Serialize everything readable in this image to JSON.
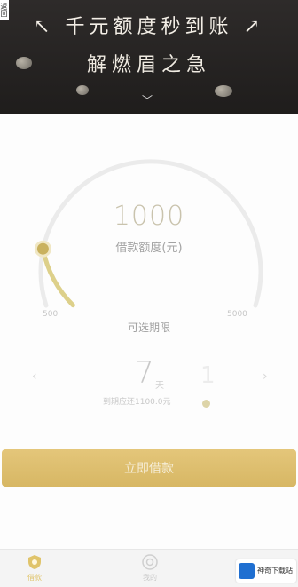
{
  "banner": {
    "side_label": "返回",
    "headline": "千元额度秒到账",
    "subline": "解燃眉之急"
  },
  "loan": {
    "amount": "1000",
    "amount_label": "借款额度(元)",
    "range_min": "500",
    "range_max": "5000",
    "term_title": "可选期限",
    "term_value": "7",
    "term_unit": "天",
    "term_next_value": "1",
    "repay_info": "到期应还1100.0元",
    "apply_label": "立即借款",
    "slider_level": 0.125
  },
  "tabbar": {
    "home_label": "借款",
    "mine_label": "我的"
  },
  "watermark": {
    "text": "神奇下载站"
  },
  "colors": {
    "accent": "#e0c46b",
    "banner_bg": "#23201f"
  }
}
